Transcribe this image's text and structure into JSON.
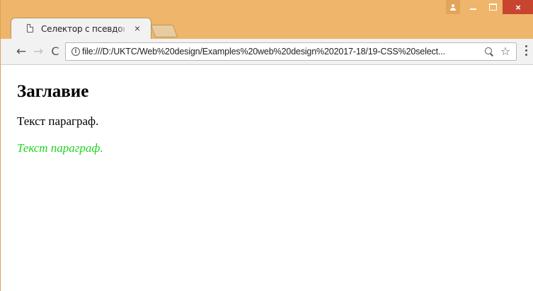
{
  "browser": {
    "tab_title": "Селектор с псевдоклас",
    "tab_close": "×",
    "url": "file:///D:/UKTC/Web%20design/Examples%20web%20design%202017-18/19-CSS%20select...",
    "window_controls": {
      "close": "×"
    },
    "nav": {
      "back": "←",
      "forward": "→",
      "reload": "C"
    },
    "star": "☆",
    "accent_color": "#eeb56b",
    "icons": [
      "page-icon",
      "user-icon",
      "minimize-icon",
      "maximize-icon",
      "close-icon",
      "back-arrow-icon",
      "forward-arrow-icon",
      "reload-icon",
      "info-icon",
      "zoom-icon",
      "star-icon",
      "menu-icon"
    ]
  },
  "page": {
    "heading": "Заглавие",
    "paragraph_1": "Текст параграф.",
    "paragraph_2": "Текст параграф.",
    "paragraph_2_color": "#1fd41f"
  }
}
